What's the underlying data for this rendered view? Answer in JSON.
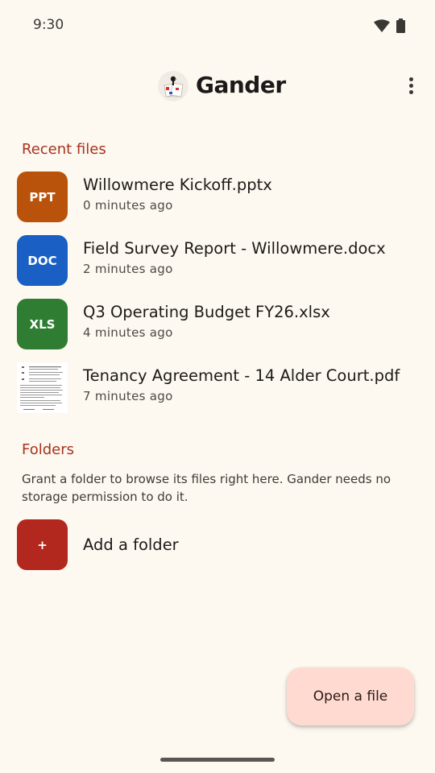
{
  "status_bar": {
    "time": "9:30",
    "wifi_icon": "wifi-icon",
    "battery_icon": "battery-icon"
  },
  "header": {
    "title": "Gander",
    "logo_icon": "gander-logo-icon",
    "menu_icon": "more-vert-icon"
  },
  "recent": {
    "title": "Recent files",
    "files": [
      {
        "badge": "PPT",
        "badge_color": "#b9530b",
        "name": "Willowmere Kickoff.pptx",
        "time": "0 minutes ago"
      },
      {
        "badge": "DOC",
        "badge_color": "#1a5fc4",
        "name": "Field Survey Report - Willowmere.docx",
        "time": "2 minutes ago"
      },
      {
        "badge": "XLS",
        "badge_color": "#2e7d32",
        "name": "Q3 Operating Budget FY26.xlsx",
        "time": "4 minutes ago"
      },
      {
        "badge": "",
        "badge_color": "#ffffff",
        "name": "Tenancy Agreement - 14 Alder Court.pdf",
        "time": "7 minutes ago"
      }
    ]
  },
  "folders": {
    "title": "Folders",
    "description": "Grant a folder to browse its files right here. Gander needs no storage permission to do it.",
    "add_badge": "+",
    "add_label": "Add a folder",
    "add_color": "#b2281e"
  },
  "fab": {
    "label": "Open a file"
  },
  "colors": {
    "background": "#fdf8f0",
    "accent": "#a8321f",
    "fab": "#ffdad1"
  }
}
